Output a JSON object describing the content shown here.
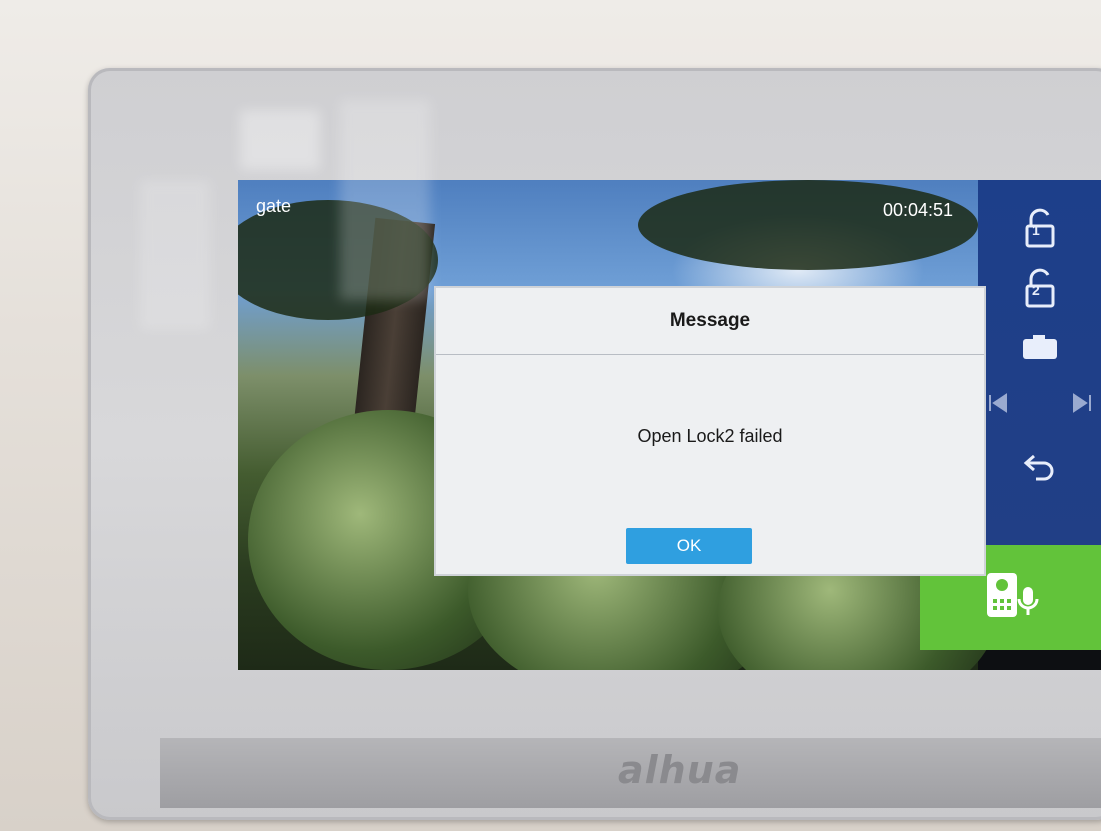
{
  "device": {
    "brand_logo": "alhua"
  },
  "video": {
    "camera_name": "gate",
    "call_timer": "00:04:51"
  },
  "sidebar": {
    "unlock1_label": "1",
    "unlock2_label": "2"
  },
  "dialog": {
    "title": "Message",
    "message": "Open Lock2 failed",
    "ok_label": "OK"
  },
  "colors": {
    "sidebar": "#1d3f8a",
    "talk_button": "#62c33a",
    "ok_button": "#2f9fe0"
  }
}
